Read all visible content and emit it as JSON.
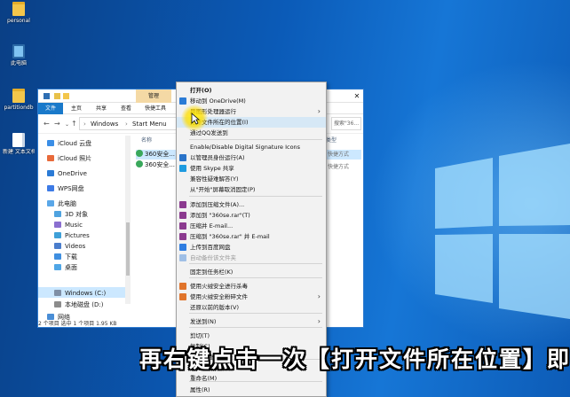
{
  "desktop": {
    "icons": [
      {
        "label": "personal",
        "kind": "folder"
      },
      {
        "label": "此电脑",
        "kind": "pc"
      },
      {
        "label": "partitiondb",
        "kind": "folder"
      },
      {
        "label": "新建 文本文档",
        "kind": "doc"
      }
    ]
  },
  "explorer": {
    "manage_tab": "管理",
    "ribbon_tabs": [
      "文件",
      "主页",
      "共享",
      "查看",
      "快捷工具"
    ],
    "breadcrumb": [
      "Windows",
      "Start Menu"
    ],
    "search_placeholder": "搜索\"36...",
    "column_name": "名称",
    "column_type": "类型",
    "nav_items": [
      {
        "label": "iCloud 云盘",
        "color": "#3a8ee6"
      },
      {
        "label": "iCloud 照片",
        "color": "#e86a3a"
      },
      {
        "label": "OneDrive",
        "color": "#2b7bd6"
      },
      {
        "label": "WPS网盘",
        "color": "#3d7be6"
      },
      {
        "label": "此电脑",
        "color": "#5aa7e8"
      },
      {
        "label": "3D 对象",
        "color": "#4fa3e0"
      },
      {
        "label": "Music",
        "color": "#8a6fd0"
      },
      {
        "label": "Pictures",
        "color": "#3fa0d8"
      },
      {
        "label": "Videos",
        "color": "#4a7dcc"
      },
      {
        "label": "下载",
        "color": "#3f8fe0"
      },
      {
        "label": "桌面",
        "color": "#4fa6e6"
      },
      {
        "label": "Windows (C:)",
        "color": "#7f8fa6"
      },
      {
        "label": "本地磁盘 (D:)",
        "color": "#8c8c8c"
      },
      {
        "label": "网络",
        "color": "#4a8ed6"
      }
    ],
    "files": [
      {
        "name": "360安全...",
        "type": "快捷方式"
      },
      {
        "name": "360安全...",
        "type": "快捷方式"
      }
    ],
    "status": "2 个项目    选中 1 个项目  1.95 KB"
  },
  "context_menu": {
    "items": [
      {
        "label": "打开(O)",
        "bold": true
      },
      {
        "label": "移动到 OneDrive(M)",
        "icon_color": "#2b7bd6"
      },
      {
        "label": "用图形处理器运行",
        "submenu": true
      },
      {
        "label": "打开文件所在的位置(I)",
        "highlight": true
      },
      {
        "label": "通过QQ发送到"
      },
      {
        "label": "Enable/Disable Digital Signature Icons"
      },
      {
        "label": "以管理员身份运行(A)",
        "icon_color": "#2a74c9"
      },
      {
        "label": "使用 Skype 共享",
        "icon_color": "#1e9be0"
      },
      {
        "label": "兼容性疑难解答(Y)"
      },
      {
        "label": "从\"开始\"屏幕取消固定(P)"
      },
      {
        "label": "添加到压缩文件(A)...",
        "icon_color": "#8b3a8f"
      },
      {
        "label": "添加到 \"360se.rar\"(T)",
        "icon_color": "#8b3a8f"
      },
      {
        "label": "压缩并 E-mail...",
        "icon_color": "#8b3a8f"
      },
      {
        "label": "压缩到 \"360se.rar\" 并 E-mail",
        "icon_color": "#8b3a8f"
      },
      {
        "label": "上传到百度网盘",
        "icon_color": "#2f7de1"
      },
      {
        "label": "自动备份该文件夹",
        "dim": true,
        "icon_color": "#9fbfe6"
      },
      {
        "label": "固定到任务栏(K)"
      },
      {
        "label": "使用火绒安全进行杀毒",
        "icon_color": "#e0742b"
      },
      {
        "label": "使用火绒安全粉碎文件",
        "submenu": true,
        "icon_color": "#e0742b"
      },
      {
        "label": "还原以前的版本(V)"
      },
      {
        "label": "发送到(N)",
        "submenu": true
      },
      {
        "label": "剪切(T)"
      },
      {
        "label": "复制(C)"
      },
      {
        "label": "创建快捷方式(S)"
      },
      {
        "label": "删除(D)"
      },
      {
        "label": "重命名(M)"
      },
      {
        "label": "属性(R)"
      }
    ]
  },
  "subtitle": "再右键点击一次【打开文件所在位置】即可"
}
